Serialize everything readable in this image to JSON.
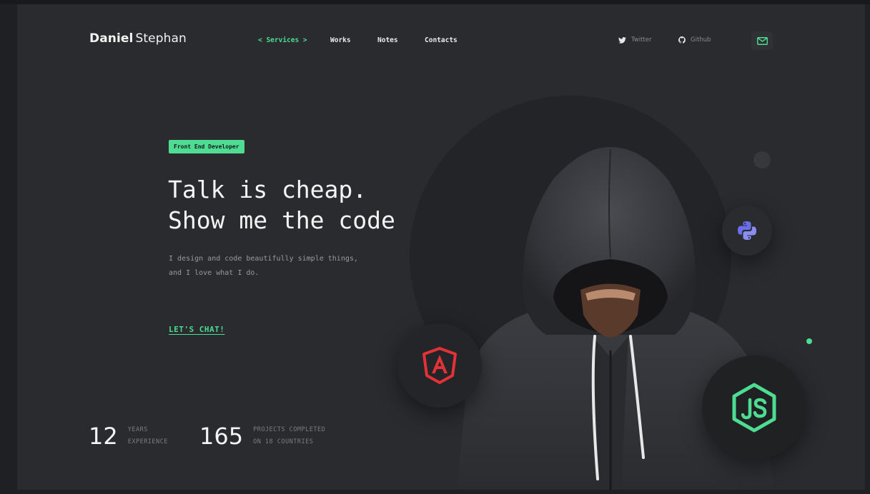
{
  "header": {
    "logo_first": "Daniel",
    "logo_last": "Stephan",
    "nav": [
      {
        "label": "< Services >",
        "active": true
      },
      {
        "label": "Works",
        "active": false
      },
      {
        "label": "Notes",
        "active": false
      },
      {
        "label": "Contacts",
        "active": false
      }
    ],
    "social": [
      {
        "label": "Twitter",
        "icon": "twitter-icon"
      },
      {
        "label": "Github",
        "icon": "github-icon"
      }
    ],
    "mail_icon": "mail-icon"
  },
  "hero": {
    "badge": "Front End Developer",
    "headline_line1": "Talk is cheap.",
    "headline_line2": "Show me the code",
    "sub_line1": "I design and code beautifully simple things,",
    "sub_line2": "and I love what I do.",
    "cta": "LET'S CHAT!"
  },
  "stats": [
    {
      "value": "12",
      "label_line1": "YEARS",
      "label_line2": "EXPERIENCE"
    },
    {
      "value": "165",
      "label_line1": "PROJECTS COMPLETED",
      "label_line2": "ON 18 COUNTRIES"
    }
  ],
  "tech": {
    "angular": "angular-icon",
    "node": "nodejs-icon",
    "python": "python-icon"
  },
  "colors": {
    "accent": "#4ddc92",
    "background": "#2a2b2e",
    "angular": "#e23237",
    "python": "#6a6ee8"
  }
}
